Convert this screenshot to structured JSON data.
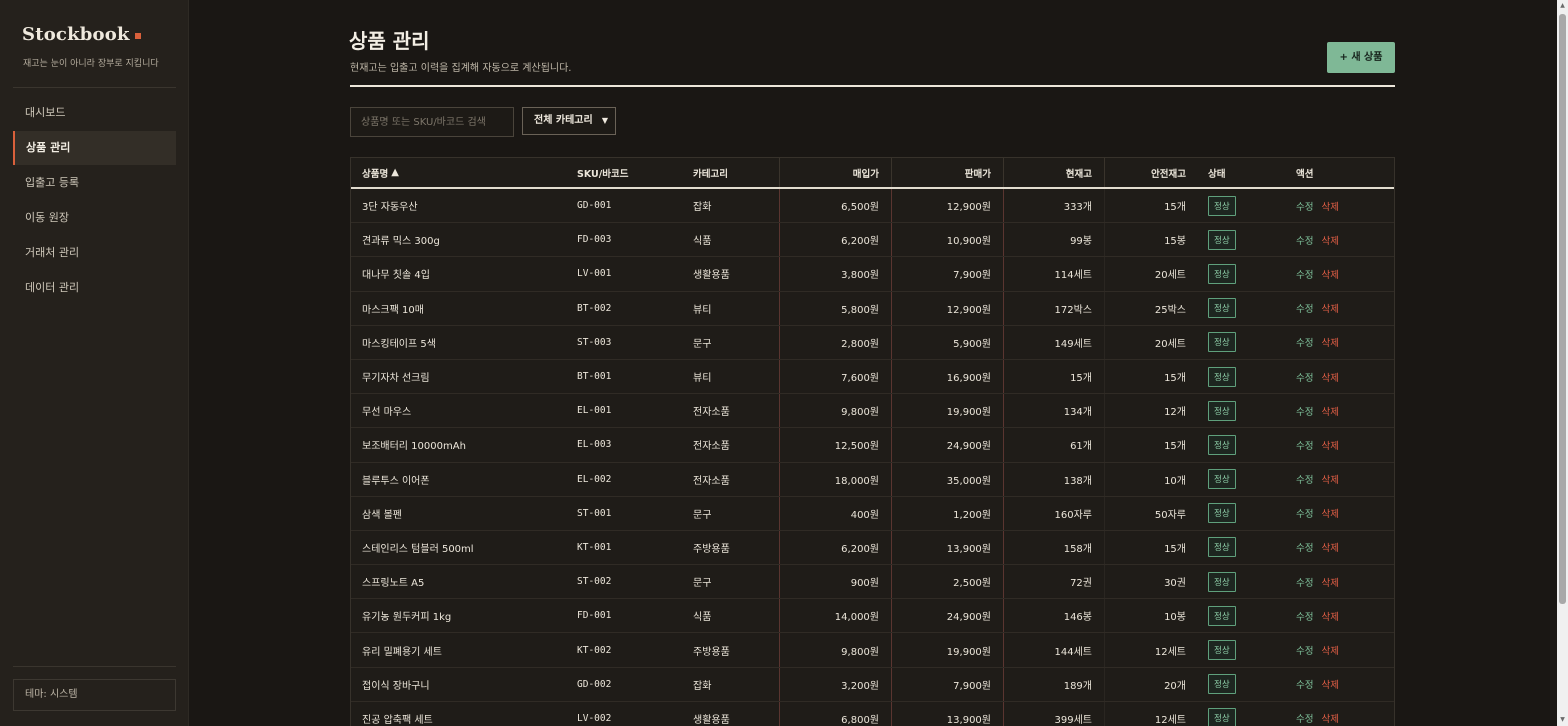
{
  "sidebar": {
    "brand": "Stockbook",
    "tagline": "재고는 눈이 아니라 장부로 지킵니다",
    "items": [
      {
        "label": "대시보드"
      },
      {
        "label": "상품 관리"
      },
      {
        "label": "입출고 등록"
      },
      {
        "label": "이동 원장"
      },
      {
        "label": "거래처 관리"
      },
      {
        "label": "데이터 관리"
      }
    ],
    "theme_label": "테마: 시스템"
  },
  "header": {
    "title": "상품 관리",
    "subtitle": "현재고는 입출고 이력을 집계해 자동으로 계산됩니다.",
    "new_button": "+ 새 상품"
  },
  "filters": {
    "search_placeholder": "상품명 또는 SKU/바코드 검색",
    "category_selected": "전체 카테고리"
  },
  "table": {
    "columns": {
      "name": "상품명",
      "sku": "SKU/바코드",
      "category": "카테고리",
      "buy": "매입가",
      "sell": "판매가",
      "stock": "현재고",
      "safety": "안전재고",
      "status": "상태",
      "actions": "액션"
    },
    "sort_indicator": "▲",
    "edit_label": "수정",
    "delete_label": "삭제",
    "rows": [
      {
        "name": "3단 자동우산",
        "sku": "GD-001",
        "category": "잡화",
        "buy": "6,500원",
        "sell": "12,900원",
        "stock": "333개",
        "safety": "15개",
        "status": "정상"
      },
      {
        "name": "견과류 믹스 300g",
        "sku": "FD-003",
        "category": "식품",
        "buy": "6,200원",
        "sell": "10,900원",
        "stock": "99봉",
        "safety": "15봉",
        "status": "정상"
      },
      {
        "name": "대나무 칫솔 4입",
        "sku": "LV-001",
        "category": "생활용품",
        "buy": "3,800원",
        "sell": "7,900원",
        "stock": "114세트",
        "safety": "20세트",
        "status": "정상"
      },
      {
        "name": "마스크팩 10매",
        "sku": "BT-002",
        "category": "뷰티",
        "buy": "5,800원",
        "sell": "12,900원",
        "stock": "172박스",
        "safety": "25박스",
        "status": "정상"
      },
      {
        "name": "마스킹테이프 5색",
        "sku": "ST-003",
        "category": "문구",
        "buy": "2,800원",
        "sell": "5,900원",
        "stock": "149세트",
        "safety": "20세트",
        "status": "정상"
      },
      {
        "name": "무기자차 선크림",
        "sku": "BT-001",
        "category": "뷰티",
        "buy": "7,600원",
        "sell": "16,900원",
        "stock": "15개",
        "safety": "15개",
        "status": "정상"
      },
      {
        "name": "무선 마우스",
        "sku": "EL-001",
        "category": "전자소품",
        "buy": "9,800원",
        "sell": "19,900원",
        "stock": "134개",
        "safety": "12개",
        "status": "정상"
      },
      {
        "name": "보조배터리 10000mAh",
        "sku": "EL-003",
        "category": "전자소품",
        "buy": "12,500원",
        "sell": "24,900원",
        "stock": "61개",
        "safety": "15개",
        "status": "정상"
      },
      {
        "name": "블루투스 이어폰",
        "sku": "EL-002",
        "category": "전자소품",
        "buy": "18,000원",
        "sell": "35,000원",
        "stock": "138개",
        "safety": "10개",
        "status": "정상"
      },
      {
        "name": "삼색 볼펜",
        "sku": "ST-001",
        "category": "문구",
        "buy": "400원",
        "sell": "1,200원",
        "stock": "160자루",
        "safety": "50자루",
        "status": "정상"
      },
      {
        "name": "스테인리스 텀블러 500ml",
        "sku": "KT-001",
        "category": "주방용품",
        "buy": "6,200원",
        "sell": "13,900원",
        "stock": "158개",
        "safety": "15개",
        "status": "정상"
      },
      {
        "name": "스프링노트 A5",
        "sku": "ST-002",
        "category": "문구",
        "buy": "900원",
        "sell": "2,500원",
        "stock": "72권",
        "safety": "30권",
        "status": "정상"
      },
      {
        "name": "유기농 원두커피 1kg",
        "sku": "FD-001",
        "category": "식품",
        "buy": "14,000원",
        "sell": "24,900원",
        "stock": "146봉",
        "safety": "10봉",
        "status": "정상"
      },
      {
        "name": "유리 밀폐용기 세트",
        "sku": "KT-002",
        "category": "주방용품",
        "buy": "9,800원",
        "sell": "19,900원",
        "stock": "144세트",
        "safety": "12세트",
        "status": "정상"
      },
      {
        "name": "접이식 장바구니",
        "sku": "GD-002",
        "category": "잡화",
        "buy": "3,200원",
        "sell": "7,900원",
        "stock": "189개",
        "safety": "20개",
        "status": "정상"
      },
      {
        "name": "진공 압축팩 세트",
        "sku": "LV-002",
        "category": "생활용품",
        "buy": "6,800원",
        "sell": "13,900원",
        "stock": "399세트",
        "safety": "12세트",
        "status": "정상"
      }
    ]
  },
  "colors": {
    "accent": "#d9603b",
    "primary_button": "#7fb896",
    "status_ok": "#8fd0aa",
    "delete": "#e35f46"
  }
}
